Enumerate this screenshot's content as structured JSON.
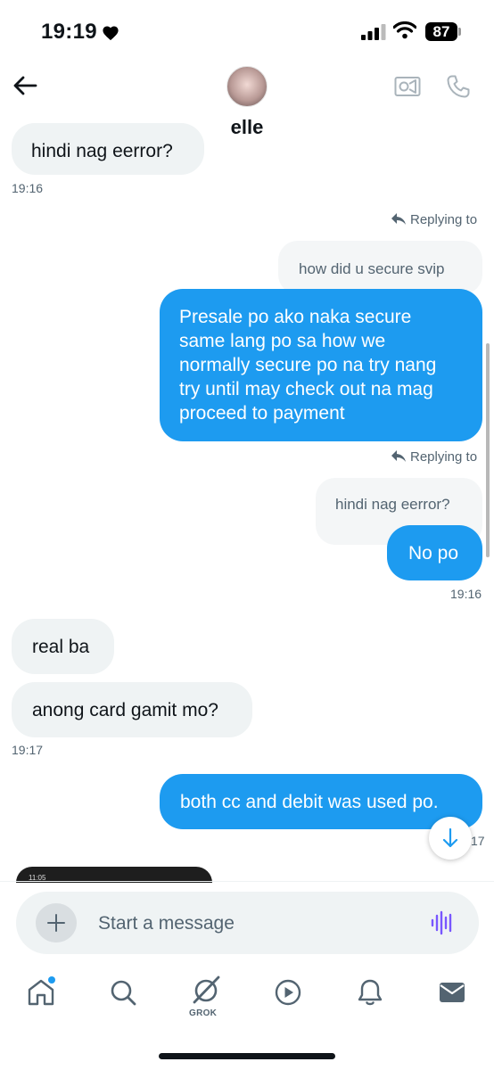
{
  "status_bar": {
    "time": "19:19",
    "battery": "87"
  },
  "header": {
    "contact_name": "elle"
  },
  "messages": {
    "partial_top": {
      "text": "hindi nag eerror?",
      "time": "19:16"
    },
    "reply_1": {
      "replying_label": "Replying to",
      "quoted": "how did u secure svip"
    },
    "sent_1": [
      "Presale po ako naka secure",
      "same lang po sa how we",
      "normally secure po na try nang",
      "try until may check out na mag",
      "proceed to payment"
    ],
    "reply_2": {
      "replying_label": "Replying to",
      "quoted": "hindi nag eerror?"
    },
    "sent_2": {
      "text": "No po",
      "time": "19:16"
    },
    "recv_1": "real ba",
    "recv_2": {
      "text": "anong card gamit mo?",
      "time": "19:17"
    },
    "sent_3": {
      "text": "both cc and debit was used po.",
      "time_partial": "17"
    },
    "thumbnail_time": "11:05"
  },
  "composer": {
    "placeholder": "Start a message"
  },
  "nav": {
    "grok_label": "GROK"
  },
  "colors": {
    "accent": "#1d9bf0",
    "received_bubble": "#eff3f4",
    "text": "#0f1419",
    "muted": "#536471",
    "voice_icon": "#7856ff"
  },
  "icons": [
    "heart-icon",
    "signal-icon",
    "wifi-icon",
    "back-arrow-icon",
    "video-call-icon",
    "phone-call-icon",
    "reply-arrow-icon",
    "arrow-down-icon",
    "plus-icon",
    "voice-icon",
    "home-icon",
    "search-icon",
    "grok-icon",
    "play-icon",
    "bell-icon",
    "mail-icon"
  ]
}
